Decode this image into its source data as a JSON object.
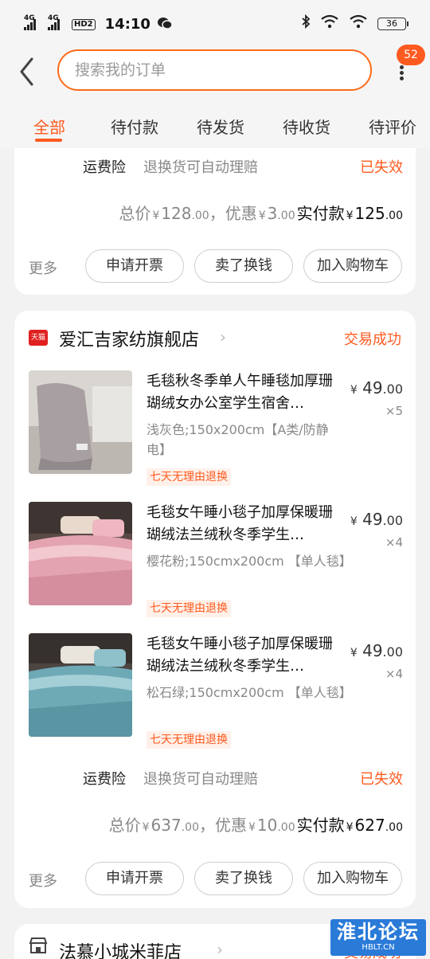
{
  "status_bar": {
    "signal1": "4G",
    "signal2": "4G",
    "hd": "HD2",
    "time": "14:10",
    "battery": "36"
  },
  "header": {
    "search_placeholder": "搜索我的订单",
    "badge_count": "52"
  },
  "tabs": [
    {
      "label": "全部",
      "active": true
    },
    {
      "label": "待付款"
    },
    {
      "label": "待发货"
    },
    {
      "label": "待收货"
    },
    {
      "label": "待评价"
    }
  ],
  "orders": [
    {
      "insurance_label": "运费险",
      "insurance_desc": "退换货可自动理赔",
      "insurance_status": "已失效",
      "total_label": "总价",
      "total_int": "128",
      "total_dec": ".00",
      "discount_label": "，优惠",
      "discount_int": "3",
      "discount_dec": ".00",
      "pay_label": "实付款",
      "pay_int": "125",
      "pay_dec": ".00",
      "currency": "¥",
      "more_label": "更多",
      "buttons": [
        "申请开票",
        "卖了换钱",
        "加入购物车"
      ]
    },
    {
      "store_badge": "天猫",
      "store_name": "爱汇吉家纺旗舰店",
      "status": "交易成功",
      "items": [
        {
          "title": "毛毯秋冬季单人午睡毯加厚珊瑚绒女办公室学生宿舍…",
          "sku": "浅灰色;150x200cm【A类/防静电】",
          "tag": "七天无理由退换",
          "price_int": "49",
          "price_dec": ".00",
          "qty": "×5",
          "color": "#9a9496"
        },
        {
          "title": "毛毯女午睡小毯子加厚保暖珊瑚绒法兰绒秋冬季学生…",
          "sku": "樱花粉;150cmx200cm 【单人毯】",
          "tag": "七天无理由退换",
          "price_int": "49",
          "price_dec": ".00",
          "qty": "×4",
          "color": "#e4a9b4"
        },
        {
          "title": "毛毯女午睡小毯子加厚保暖珊瑚绒法兰绒秋冬季学生…",
          "sku": "松石绿;150cmx200cm 【单人毯】",
          "tag": "七天无理由退换",
          "price_int": "49",
          "price_dec": ".00",
          "qty": "×4",
          "color": "#6fa7b5"
        }
      ],
      "insurance_label": "运费险",
      "insurance_desc": "退换货可自动理赔",
      "insurance_status": "已失效",
      "total_label": "总价",
      "total_int": "637",
      "total_dec": ".00",
      "discount_label": "，优惠",
      "discount_int": "10",
      "discount_dec": ".00",
      "pay_label": "实付款",
      "pay_int": "627",
      "pay_dec": ".00",
      "currency": "¥",
      "more_label": "更多",
      "buttons": [
        "申请开票",
        "卖了换钱",
        "加入购物车"
      ]
    },
    {
      "store_name": "法慕小城米菲店",
      "status": "交易成功"
    }
  ],
  "watermark": {
    "text": "淮北论坛",
    "url": "HBLT.CN"
  }
}
